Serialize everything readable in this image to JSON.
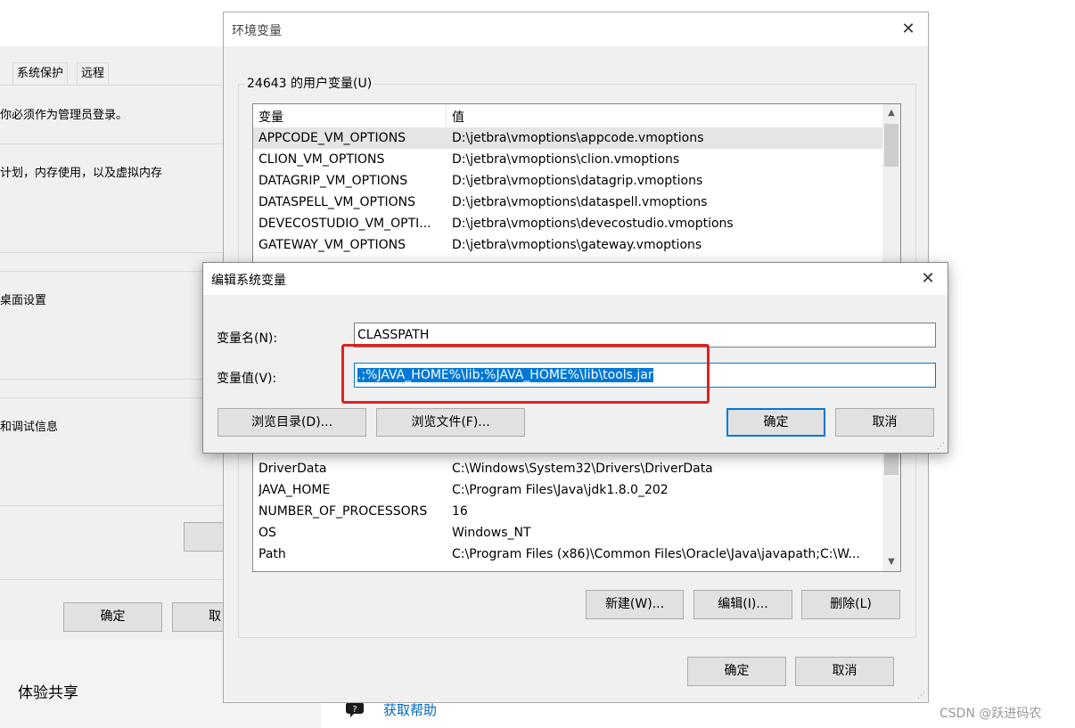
{
  "left_window": {
    "tabs": [
      "系统保护",
      "远程"
    ],
    "admin_note": "你必须作为管理员登录。",
    "perf_desc": "计划，内存使用，以及虚拟内存",
    "profile_desc": "桌面设置",
    "startup_desc": "和调试信息",
    "ok_label": "确定",
    "cancel_label": "取"
  },
  "settings_bg": {
    "share_label": "体验共享",
    "help_label": "获取帮助"
  },
  "env_window": {
    "title": "环境变量",
    "user_vars_label": "24643 的用户变量(U)",
    "columns": [
      "变量",
      "值"
    ],
    "user_rows": [
      {
        "name": "APPCODE_VM_OPTIONS",
        "value": "D:\\jetbra\\vmoptions\\appcode.vmoptions"
      },
      {
        "name": "CLION_VM_OPTIONS",
        "value": "D:\\jetbra\\vmoptions\\clion.vmoptions"
      },
      {
        "name": "DATAGRIP_VM_OPTIONS",
        "value": "D:\\jetbra\\vmoptions\\datagrip.vmoptions"
      },
      {
        "name": "DATASPELL_VM_OPTIONS",
        "value": "D:\\jetbra\\vmoptions\\dataspell.vmoptions"
      },
      {
        "name": "DEVECOSTUDIO_VM_OPTI...",
        "value": "D:\\jetbra\\vmoptions\\devecostudio.vmoptions"
      },
      {
        "name": "GATEWAY_VM_OPTIONS",
        "value": "D:\\jetbra\\vmoptions\\gateway.vmoptions"
      }
    ],
    "system_rows": [
      {
        "name": "DriverData",
        "value": "C:\\Windows\\System32\\Drivers\\DriverData"
      },
      {
        "name": "JAVA_HOME",
        "value": "C:\\Program Files\\Java\\jdk1.8.0_202"
      },
      {
        "name": "NUMBER_OF_PROCESSORS",
        "value": "16"
      },
      {
        "name": "OS",
        "value": "Windows_NT"
      },
      {
        "name": "Path",
        "value": "C:\\Program Files (x86)\\Common Files\\Oracle\\Java\\javapath;C:\\W..."
      }
    ],
    "new_label": "新建(W)...",
    "edit_label": "编辑(I)...",
    "delete_label": "删除(L)",
    "ok_label": "确定",
    "cancel_label": "取消"
  },
  "edit_dialog": {
    "title": "编辑系统变量",
    "name_label": "变量名(N):",
    "value_label": "变量值(V):",
    "name_value": "CLASSPATH",
    "value_value": ".;%JAVA_HOME%\\lib;%JAVA_HOME%\\lib\\tools.jar",
    "browse_dir_label": "浏览目录(D)...",
    "browse_file_label": "浏览文件(F)...",
    "ok_label": "确定",
    "cancel_label": "取消"
  },
  "watermark": "CSDN @跃进码农",
  "colors": {
    "selection": "#0078d7",
    "highlight_box": "#e02020",
    "dialog_bg": "#f0f0f0"
  }
}
